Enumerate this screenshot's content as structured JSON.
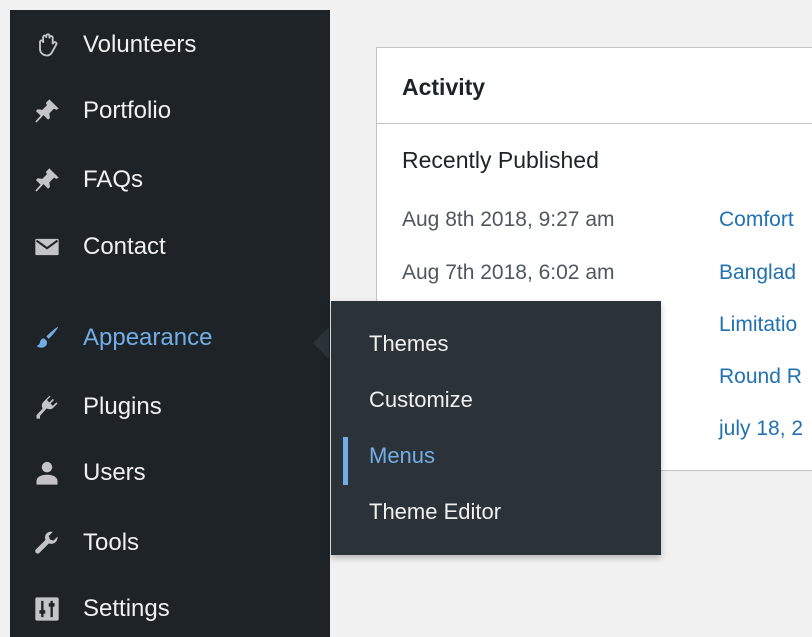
{
  "sidebar": {
    "items": [
      {
        "label": "Volunteers",
        "icon": "hand-icon"
      },
      {
        "label": "Portfolio",
        "icon": "pin-icon"
      },
      {
        "label": "FAQs",
        "icon": "pin-icon"
      },
      {
        "label": "Contact",
        "icon": "envelope-icon"
      },
      {
        "label": "Appearance",
        "icon": "paintbrush-icon",
        "active": true
      },
      {
        "label": "Plugins",
        "icon": "plug-icon"
      },
      {
        "label": "Users",
        "icon": "user-icon"
      },
      {
        "label": "Tools",
        "icon": "wrench-icon"
      },
      {
        "label": "Settings",
        "icon": "sliders-icon"
      }
    ]
  },
  "submenu": {
    "items": [
      {
        "label": "Themes"
      },
      {
        "label": "Customize"
      },
      {
        "label": "Menus",
        "current": true
      },
      {
        "label": "Theme Editor"
      }
    ]
  },
  "activity": {
    "title": "Activity",
    "section_title": "Recently Published",
    "rows": [
      {
        "date": "Aug 8th 2018, 9:27 am",
        "link": "Comfort"
      },
      {
        "date": "Aug 7th 2018, 6:02 am",
        "link": "Banglad"
      },
      {
        "date": "",
        "link": "Limitatio"
      },
      {
        "date": "",
        "link": "Round R"
      },
      {
        "date": "",
        "link": "july 18, 2"
      }
    ]
  },
  "colors": {
    "sidebar_bg": "#1e2327",
    "submenu_bg": "#2c3338",
    "accent": "#72aee6",
    "link": "#2271b1",
    "page_bg": "#f1f1f1"
  }
}
